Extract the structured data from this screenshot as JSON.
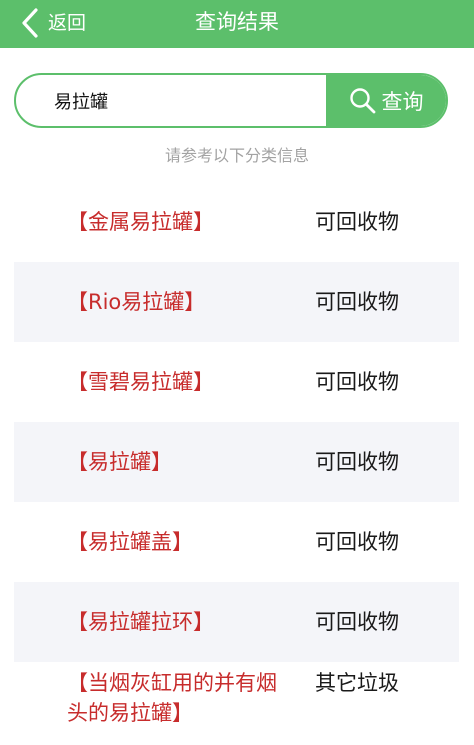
{
  "header": {
    "back_label": "返回",
    "title": "查询结果"
  },
  "search": {
    "value": "易拉罐",
    "button_label": "查询"
  },
  "hint": "请参考以下分类信息",
  "results": [
    {
      "name": "【金属易拉罐】",
      "category": "可回收物"
    },
    {
      "name": "【Rio易拉罐】",
      "category": "可回收物"
    },
    {
      "name": "【雪碧易拉罐】",
      "category": "可回收物"
    },
    {
      "name": "【易拉罐】",
      "category": "可回收物"
    },
    {
      "name": "【易拉罐盖】",
      "category": "可回收物"
    },
    {
      "name": "【易拉罐拉环】",
      "category": "可回收物"
    },
    {
      "name": "【当烟灰缸用的并有烟头的易拉罐】",
      "category": "其它垃圾"
    }
  ],
  "colors": {
    "brand": "#5cbf6b",
    "item_name": "#c72c2c",
    "row_shade": "#f4f5f9",
    "hint": "#a3a3a3"
  },
  "icons": {
    "back": "chevron-left-icon",
    "search": "magnifier-icon"
  }
}
